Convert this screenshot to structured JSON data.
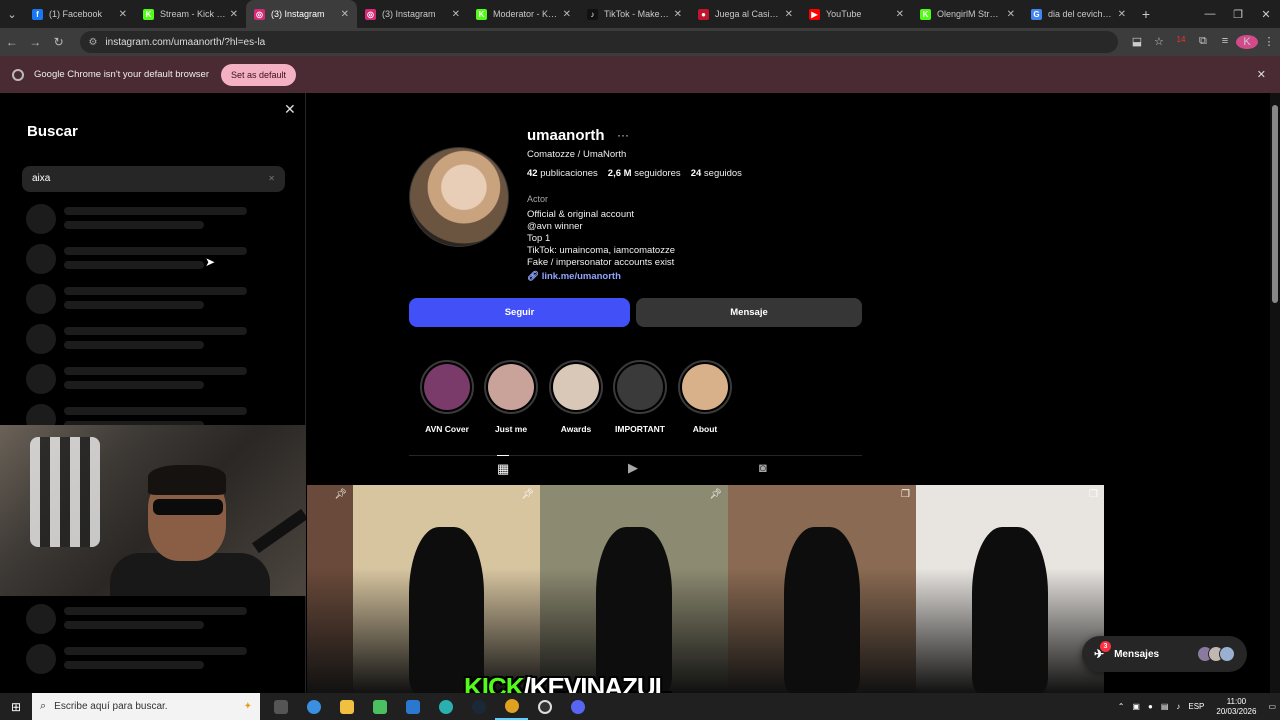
{
  "browser": {
    "tabs": [
      {
        "title": "(1) Facebook",
        "icon": "facebook-icon",
        "color": "#1877f2",
        "glyph": "f"
      },
      {
        "title": "Stream - Kick Dashboard",
        "icon": "kick-icon",
        "color": "#53fc18",
        "glyph": "K"
      },
      {
        "title": "(3) Instagram",
        "icon": "instagram-icon",
        "color": "#d62976",
        "glyph": "◎",
        "active": true
      },
      {
        "title": "(3) Instagram",
        "icon": "instagram-icon",
        "color": "#d62976",
        "glyph": "◎"
      },
      {
        "title": "Moderator - Kick",
        "icon": "kick-icon",
        "color": "#53fc18",
        "glyph": "K"
      },
      {
        "title": "TikTok - Make Your Day",
        "icon": "tiktok-icon",
        "color": "#111111",
        "glyph": "♪"
      },
      {
        "title": "Juega al Casino Online",
        "icon": "casino-icon",
        "color": "#c0152f",
        "glyph": "●"
      },
      {
        "title": "YouTube",
        "icon": "youtube-icon",
        "color": "#ff0000",
        "glyph": "▶"
      },
      {
        "title": "OlengirlM Stream",
        "icon": "kick-icon",
        "color": "#53fc18",
        "glyph": "K"
      },
      {
        "title": "dia del ceviche - Google",
        "icon": "google-icon",
        "color": "#4285f4",
        "glyph": "G"
      }
    ],
    "url": "instagram.com/umaanorth/?hl=es-la",
    "extension_badge": "14",
    "profile_initial": "K",
    "infobar": {
      "message": "Google Chrome isn't your default browser",
      "button": "Set as default"
    }
  },
  "search_panel": {
    "title": "Buscar",
    "query": "aixa"
  },
  "profile": {
    "username": "umaanorth",
    "subtitle": "Comatozze / UmaNorth",
    "posts_count": "42",
    "posts_label": "publicaciones",
    "followers_count": "2,6 M",
    "followers_label": "seguidores",
    "following_count": "24",
    "following_label": "seguidos",
    "category": "Actor",
    "bio": [
      "Official & original account",
      "@avn winner",
      "Top 1",
      "TikTok: umaincoma, iamcomatozze",
      "Fake / impersonator accounts exist"
    ],
    "link": "link.me/umanorth",
    "follow_button": "Seguir",
    "message_button": "Mensaje",
    "highlights": [
      {
        "label": "AVN Cover",
        "color": "#7a3a6a"
      },
      {
        "label": "Just me",
        "color": "#c9a39a"
      },
      {
        "label": "Awards",
        "color": "#d9c8b8"
      },
      {
        "label": "IMPORTANT",
        "color": "#3a3a3a"
      },
      {
        "label": "About",
        "color": "#d8b08a"
      }
    ],
    "post_colors": [
      "#6a4a3a",
      "#d7c5a0",
      "#8c8a70",
      "#8a6a52",
      "#e8e4e0"
    ]
  },
  "overlay": {
    "kick": "KICK",
    "handle": "/KEVINAZUL"
  },
  "messages": {
    "label": "Mensajes",
    "badge": "3"
  },
  "taskbar": {
    "search_placeholder": "Escribe aquí para buscar.",
    "language": "ESP",
    "time": "11:00",
    "date": "20/03/2026"
  }
}
